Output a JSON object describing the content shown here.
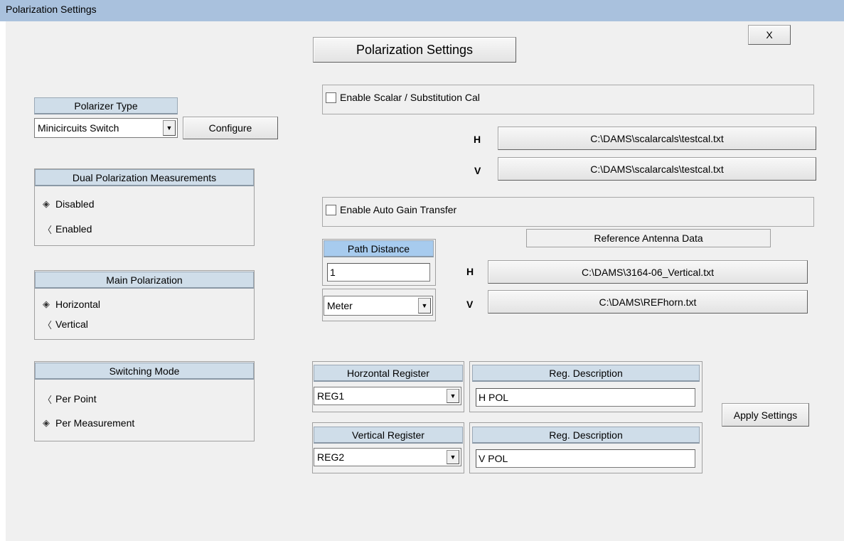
{
  "window": {
    "title": "Polarization Settings",
    "close_label": "X"
  },
  "main_title": "Polarization Settings",
  "polarizer": {
    "header": "Polarizer Type",
    "selected": "Minicircuits Switch",
    "configure_label": "Configure"
  },
  "dual_pol": {
    "header": "Dual Polarization Measurements",
    "options": [
      {
        "label": "Disabled",
        "glyph": "◈",
        "selected": true
      },
      {
        "label": "Enabled",
        "glyph": "〈",
        "selected": false
      }
    ]
  },
  "main_pol": {
    "header": "Main Polarization",
    "options": [
      {
        "label": "Horizontal",
        "glyph": "◈",
        "selected": true
      },
      {
        "label": "Vertical",
        "glyph": "〈",
        "selected": false
      }
    ]
  },
  "switching": {
    "header": "Switching Mode",
    "options": [
      {
        "label": "Per Point",
        "glyph": "〈",
        "selected": false
      },
      {
        "label": "Per Measurement",
        "glyph": "◈",
        "selected": true
      }
    ]
  },
  "scalar_cal": {
    "checkbox_label": "Enable Scalar / Substitution Cal",
    "checked": false,
    "h_label": "H",
    "v_label": "V",
    "h_file": "C:\\DAMS\\scalarcals\\testcal.txt",
    "v_file": "C:\\DAMS\\scalarcals\\testcal.txt"
  },
  "auto_gain": {
    "checkbox_label": "Enable Auto Gain Transfer",
    "checked": false,
    "ref_antenna_label": "Reference Antenna Data",
    "h_label": "H",
    "v_label": "V",
    "h_file": "C:\\DAMS\\3164-06_Vertical.txt",
    "v_file": "C:\\DAMS\\REFhorn.txt"
  },
  "path_distance": {
    "header": "Path Distance",
    "value": "1",
    "unit": "Meter"
  },
  "registers": {
    "horizontal": {
      "header": "Horzontal Register",
      "selected": "REG1",
      "desc_header": "Reg. Description",
      "desc_value": "H POL"
    },
    "vertical": {
      "header": "Vertical Register",
      "selected": "REG2",
      "desc_header": "Reg. Description",
      "desc_value": "V POL"
    }
  },
  "apply_label": "Apply Settings",
  "icons": {
    "dropdown": "chevron-down-icon",
    "radio_selected": "radio-selected-icon",
    "radio_unselected": "radio-unselected-icon"
  }
}
